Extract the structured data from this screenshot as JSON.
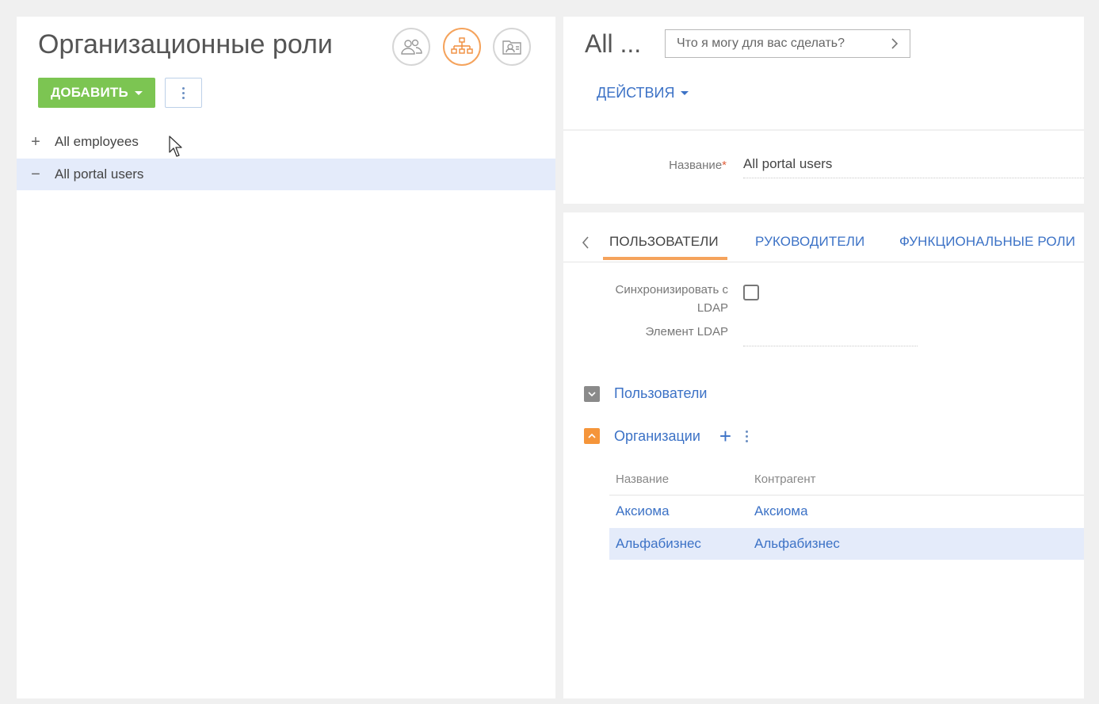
{
  "left": {
    "title": "Организационные роли",
    "view_buttons": [
      {
        "icon": "users-icon",
        "active": false
      },
      {
        "icon": "org-structure-icon",
        "active": true
      },
      {
        "icon": "contact-card-icon",
        "active": false
      }
    ],
    "add_label": "ДОБАВИТЬ",
    "tree": [
      {
        "label": "All employees",
        "toggle": "+",
        "selected": false
      },
      {
        "label": "All portal users",
        "toggle": "−",
        "selected": true
      }
    ]
  },
  "record": {
    "title": "All ...",
    "search_placeholder": "Что я могу для вас сделать?",
    "actions_label": "ДЕЙСТВИЯ",
    "name_label": "Название",
    "name_required": "*",
    "name_value": "All portal users"
  },
  "tabs": {
    "items": [
      {
        "label": "ПОЛЬЗОВАТЕЛИ",
        "active": true
      },
      {
        "label": "РУКОВОДИТЕЛИ",
        "active": false
      },
      {
        "label": "ФУНКЦИОНАЛЬНЫЕ РОЛИ",
        "active": false
      }
    ]
  },
  "ldap": {
    "sync_label_line1": "Синхронизировать с",
    "sync_label_line2": "LDAP",
    "element_label": "Элемент LDAP",
    "sync_checked": false,
    "element_value": ""
  },
  "groups": {
    "users": {
      "title": "Пользователи",
      "expanded": false
    },
    "orgs": {
      "title": "Организации",
      "expanded": true
    }
  },
  "org_grid": {
    "columns": [
      "Название",
      "Контрагент"
    ],
    "rows": [
      {
        "name": "Аксиома",
        "account": "Аксиома",
        "selected": false
      },
      {
        "name": "Альфабизнес",
        "account": "Альфабизнес",
        "selected": true
      }
    ]
  },
  "colors": {
    "accent_orange": "#f5a35c",
    "add_green": "#7cc552",
    "link_blue": "#3c72c6",
    "selected_row": "#e4ebfa"
  }
}
